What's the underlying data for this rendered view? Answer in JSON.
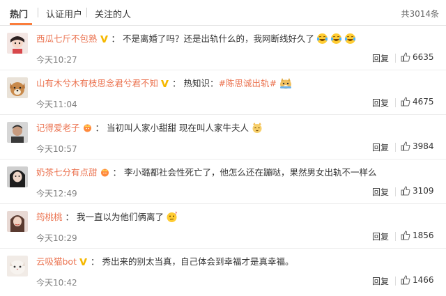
{
  "tabs": [
    {
      "label": "热门",
      "active": true
    },
    {
      "label": "认证用户",
      "active": false
    },
    {
      "label": "关注的人",
      "active": false
    }
  ],
  "total": "共3014条",
  "colors": {
    "accent": "#fa7d3c",
    "username": "#eb7350",
    "vip": "#f5b800"
  },
  "comments": [
    {
      "user": "西瓜七斤不包熟",
      "badge": "vip-icon",
      "text": "不是离婚了吗？还是出轨什么的，我网断线好久了",
      "emojis": [
        "crying-laugh-emoji",
        "crying-laugh-emoji",
        "crying-laugh-emoji"
      ],
      "time": "今天10:27",
      "reply": "回复",
      "likes": "6635"
    },
    {
      "user": "山有木兮木有枝思念君兮君不知",
      "badge": "vip-icon",
      "text_prefix": "热知识：",
      "topic": "#陈思诚出轨#",
      "emojis": [
        "doge-emoji"
      ],
      "time": "今天11:04",
      "reply": "回复",
      "likes": "4675"
    },
    {
      "user": "记得爱老子",
      "badge": "crown-icon",
      "text": "当初叫人家小甜甜 现在叫人家牛夫人",
      "emojis": [
        "cat-emoji"
      ],
      "time": "今天10:57",
      "reply": "回复",
      "likes": "3984"
    },
    {
      "user": "奶茶七分有点甜",
      "badge": "crown-icon",
      "text": "李小璐都社会性死亡了，他怎么还在蹦哒，果然男女出轨不一样么",
      "emojis": [],
      "time": "今天12:49",
      "reply": "回复",
      "likes": "3109"
    },
    {
      "user": "筠桃桃",
      "badge": "",
      "text": "我一直以为他们俩离了",
      "emojis": [
        "thinking-emoji"
      ],
      "time": "今天10:29",
      "reply": "回复",
      "likes": "1856"
    },
    {
      "user": "云吸猫bot",
      "badge": "vip-icon",
      "text": "秀出来的别太当真，自己体会到幸福才是真幸福。",
      "emojis": [],
      "time": "今天10:42",
      "reply": "回复",
      "likes": "1466"
    }
  ]
}
